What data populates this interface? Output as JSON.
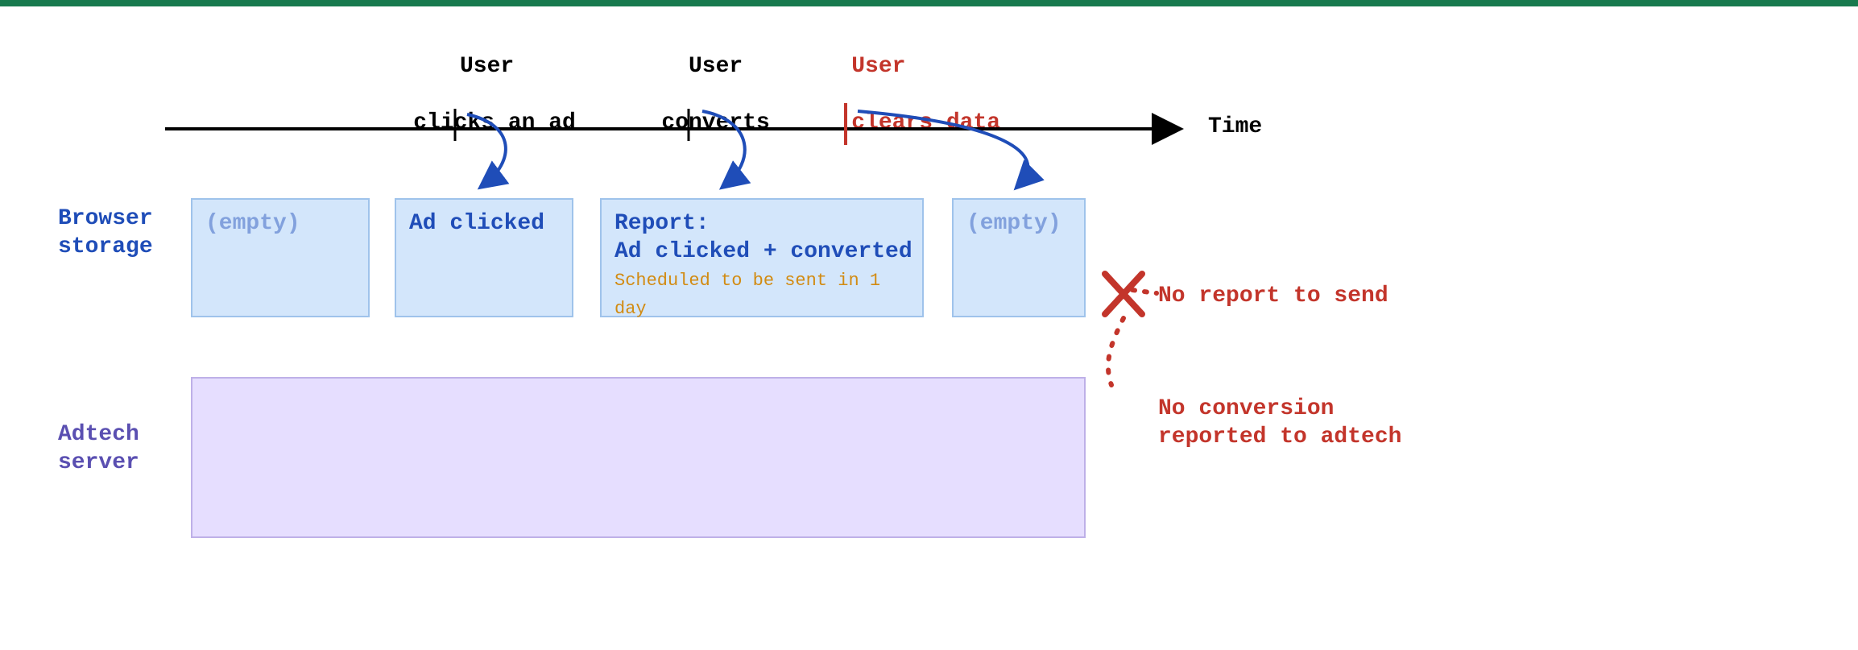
{
  "timeline": {
    "axisLabel": "Time",
    "events": [
      {
        "id": "click",
        "line1": "User",
        "line2": "clicks an ad",
        "color": "black"
      },
      {
        "id": "convert",
        "line1": "User",
        "line2": "converts",
        "color": "black"
      },
      {
        "id": "clear",
        "line1": "User",
        "line2": "clears data",
        "color": "red"
      }
    ]
  },
  "rowLabels": {
    "browser": "Browser\nstorage",
    "adtech": "Adtech\nserver"
  },
  "browserBoxes": [
    {
      "id": "initial",
      "empty": true,
      "text": "(empty)"
    },
    {
      "id": "adclicked",
      "empty": false,
      "text": "Ad clicked"
    },
    {
      "id": "report",
      "empty": false,
      "text": "Report:\nAd clicked + converted",
      "subtext": "Scheduled to be sent in 1 day"
    },
    {
      "id": "cleared",
      "empty": true,
      "text": "(empty)"
    }
  ],
  "outcome": {
    "noReport": "No report to send",
    "noConversion": "No conversion\nreported to adtech"
  }
}
